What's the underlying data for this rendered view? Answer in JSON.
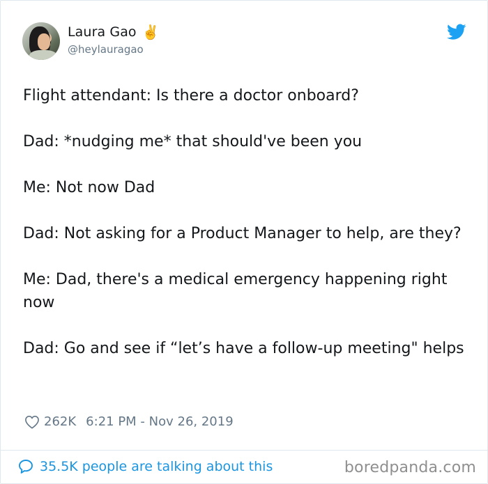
{
  "author": {
    "display_name": "Laura Gao",
    "name_emoji": "✌️",
    "handle": "@heylauragao"
  },
  "icons": {
    "avatar": "profile-photo",
    "logo": "twitter-bird-icon",
    "like": "heart-icon",
    "reply": "speech-bubble-icon"
  },
  "colors": {
    "brand_blue": "#1da1f2",
    "link_blue": "#1b95e0",
    "text": "#14171a",
    "secondary_text": "#657786",
    "watermark": "#8f8f8f"
  },
  "tweet": {
    "paragraphs": [
      "Flight attendant: Is there a doctor onboard?",
      "Dad: *nudging me* that should've been you",
      "Me: Not now Dad",
      "Dad: Not asking for a Product Manager to help, are they?",
      "Me: Dad, there's a medical emergency happening right now",
      "Dad: Go and see if “let’s have a follow-up meeting\" helps"
    ],
    "likes": "262K",
    "timestamp": "6:21 PM - Nov 26, 2019"
  },
  "footer": {
    "talking_text": "35.5K people are talking about this",
    "watermark": "boredpanda.com"
  }
}
